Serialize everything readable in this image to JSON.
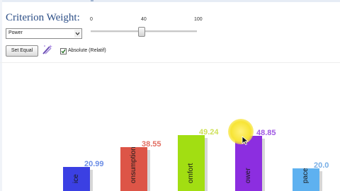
{
  "controls": {
    "title": "Criterion Weight:",
    "ticks": {
      "min": "0",
      "mid": "40",
      "max": "100"
    },
    "selected_criterion": "Power",
    "slider_value": 48,
    "set_equal_label": "Set Equal",
    "absolute_label": "Absolute (Relatif)",
    "absolute_checked": true
  },
  "icons": {
    "magic": "magic-wand-icon",
    "dropdown": "chevron-down-icon",
    "cursor": "mouse-pointer-icon",
    "check": "checkmark-icon"
  },
  "chart_data": {
    "type": "bar",
    "categories": [
      "ice",
      "onsumption",
      "omfort",
      "ower",
      "pace"
    ],
    "values": [
      20.99,
      38.55,
      49.24,
      48.85,
      20.0
    ],
    "value_labels": [
      "20.99",
      "38.55",
      "49.24",
      "48.85",
      "20.0"
    ],
    "colors": [
      "#3b40e3",
      "#dd5547",
      "#a2de12",
      "#8c2ee0",
      "#5eb1f0"
    ],
    "label_colors": [
      "#6c8ee6",
      "#e26f63",
      "#cfe15a",
      "#a059e3",
      "#77aee6"
    ]
  }
}
